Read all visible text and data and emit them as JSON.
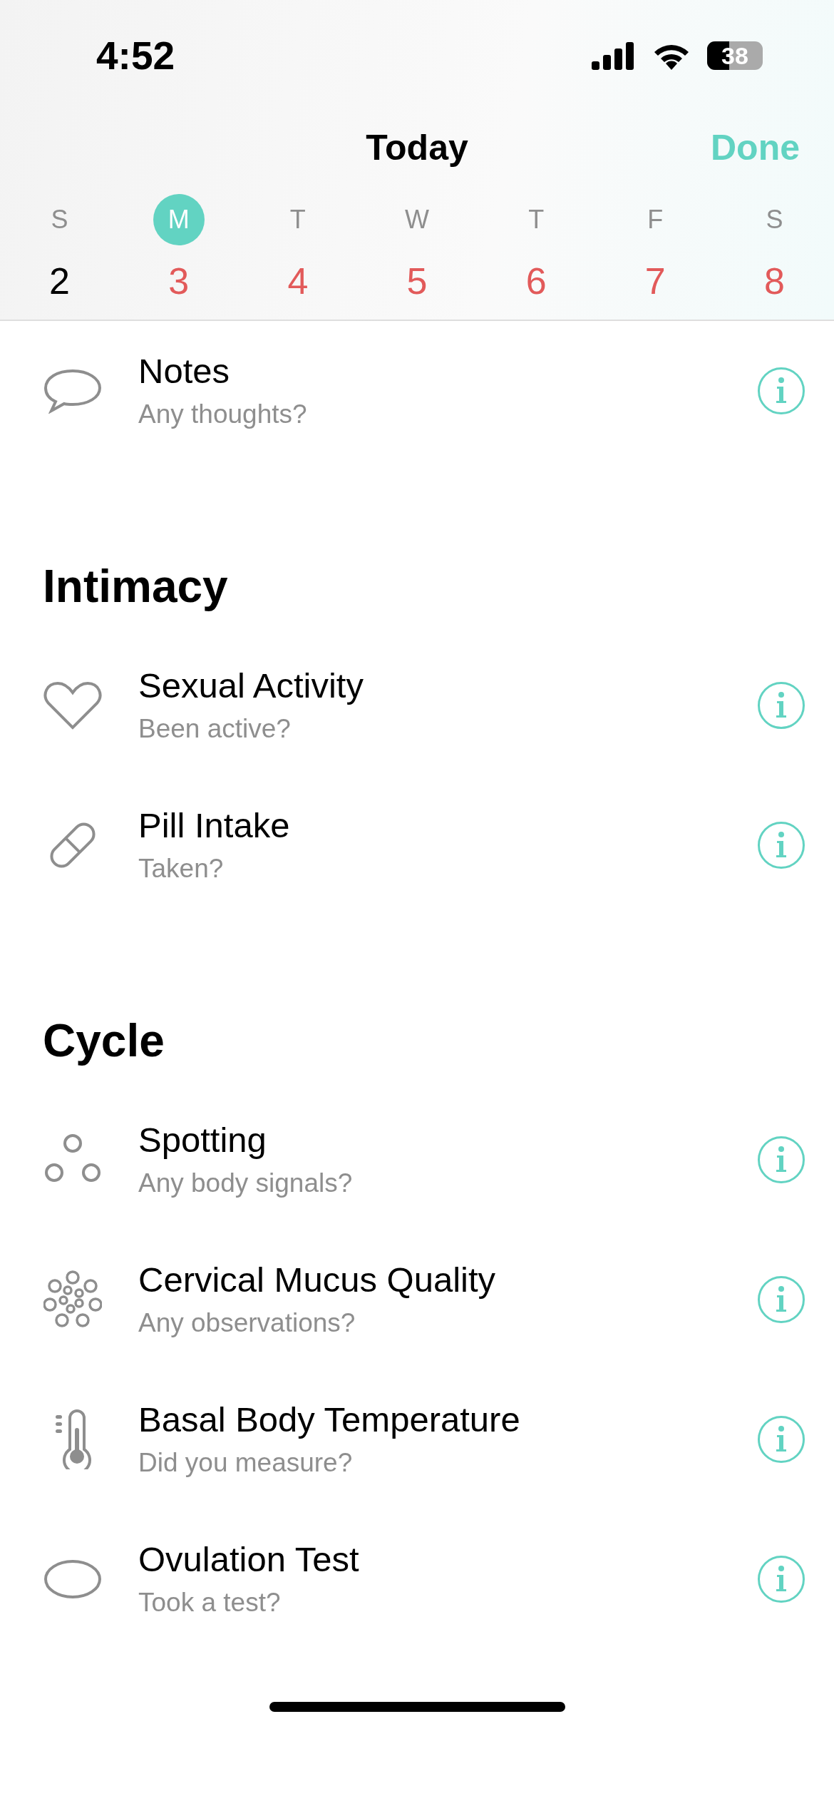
{
  "status_bar": {
    "time": "4:52",
    "battery": "38"
  },
  "nav": {
    "title": "Today",
    "done": "Done"
  },
  "week": [
    {
      "letter": "S",
      "number": "2",
      "selected": false,
      "future": false
    },
    {
      "letter": "M",
      "number": "3",
      "selected": true,
      "future": true
    },
    {
      "letter": "T",
      "number": "4",
      "selected": false,
      "future": true
    },
    {
      "letter": "W",
      "number": "5",
      "selected": false,
      "future": true
    },
    {
      "letter": "T",
      "number": "6",
      "selected": false,
      "future": true
    },
    {
      "letter": "F",
      "number": "7",
      "selected": false,
      "future": true
    },
    {
      "letter": "S",
      "number": "8",
      "selected": false,
      "future": true
    }
  ],
  "sections": [
    {
      "rows": [
        {
          "title": "Notes",
          "prompt": "Any thoughts?"
        }
      ]
    },
    {
      "title": "Intimacy",
      "rows": [
        {
          "title": "Sexual Activity",
          "prompt": "Been active?"
        },
        {
          "title": "Pill Intake",
          "prompt": "Taken?"
        }
      ]
    },
    {
      "title": "Cycle",
      "rows": [
        {
          "title": "Spotting",
          "prompt": "Any body signals?"
        },
        {
          "title": "Cervical Mucus Quality",
          "prompt": "Any observations?"
        },
        {
          "title": "Basal Body Temperature",
          "prompt": "Did you measure?"
        },
        {
          "title": "Ovulation Test",
          "prompt": "Took a test?"
        }
      ]
    }
  ]
}
